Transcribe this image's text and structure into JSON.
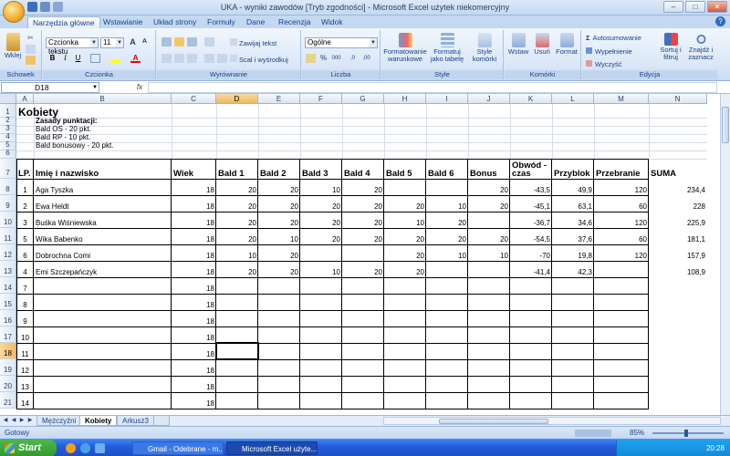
{
  "window": {
    "title": "UKA - wyniki zawodów  [Tryb zgodności]  -  Microsoft Excel użytek niekomercyjny",
    "controls": [
      "–",
      "□",
      "✕"
    ]
  },
  "ribbon_tabs": [
    "Narzędzia główne",
    "Wstawianie",
    "Układ strony",
    "Formuły",
    "Dane",
    "Recenzja",
    "Widok"
  ],
  "active_tab": "Narzędzia główne",
  "ribbon": {
    "groups": [
      "Schowek",
      "Czcionka",
      "Wyrównanie",
      "Liczba",
      "Style",
      "Komórki",
      "Edycja"
    ],
    "paste_label": "Wklej",
    "font_name": "Czcionka tekstu",
    "font_size": "11",
    "grow_font": "A",
    "shrink_font": "A",
    "bold": "B",
    "italic": "I",
    "underline": "U",
    "font_color_letter": "A",
    "wrap_text": "Zawijaj tekst",
    "merge_center": "Scal i wyśrodkuj",
    "number_format": "Ogólne",
    "percent": "%",
    "thousands": "000",
    "dec_inc": ",0",
    "dec_dec": ",00",
    "cond_format": [
      "Formatowanie",
      "warunkowe"
    ],
    "format_table": [
      "Formatuj",
      "jako tabelę"
    ],
    "cell_styles": [
      "Style",
      "komórki"
    ],
    "insert": "Wstaw",
    "delete": "Usuń",
    "format": "Format",
    "autosum": "Autosumowanie",
    "fill": "Wypełnienie",
    "clear": "Wyczyść",
    "sort_filter": [
      "Sortuj i",
      "filtruj"
    ],
    "find_select": [
      "Znajdź i",
      "zaznacz"
    ]
  },
  "formula_bar": {
    "name_box": "D18",
    "fx": "fx",
    "content": ""
  },
  "columns": [
    "A",
    "B",
    "C",
    "D",
    "E",
    "F",
    "G",
    "H",
    "I",
    "J",
    "K",
    "L",
    "M",
    "N"
  ],
  "selected_column": "D",
  "rows": [
    "1",
    "2",
    "3",
    "4",
    "5",
    "6",
    "7",
    "8",
    "9",
    "10",
    "11",
    "12",
    "13",
    "14",
    "15",
    "16",
    "17",
    "18",
    "19",
    "20",
    "21"
  ],
  "selected_row": "18",
  "sheet": {
    "title": "Kobiety",
    "rules_header": "Zasady punktacji:",
    "rules": [
      "Bald OS - 20 pkt.",
      "Bald RP - 10 pkt.",
      "Bald bonusowy - 20 pkt."
    ],
    "headers": [
      "LP.",
      "Imię i nazwisko",
      "Wiek",
      "Bald 1",
      "Bald 2",
      "Bald 3",
      "Bald 4",
      "Bald 5",
      "Bald 6",
      "Bonus",
      "Obwód - czas",
      "Przyblok",
      "Przebranie",
      "SUMA"
    ],
    "header_k_lines": [
      "Obwód -",
      "czas"
    ],
    "data_rows": [
      [
        "1",
        "Aga Tyszka",
        "18",
        "20",
        "20",
        "10",
        "20",
        "",
        "",
        "20",
        "-43,5",
        "49,9",
        "120",
        "234,4"
      ],
      [
        "2",
        "Ewa Heldt",
        "18",
        "20",
        "20",
        "20",
        "20",
        "20",
        "10",
        "20",
        "-45,1",
        "63,1",
        "60",
        "228"
      ],
      [
        "3",
        "Buśka Wiśniewska",
        "18",
        "20",
        "20",
        "20",
        "20",
        "10",
        "20",
        "",
        "-36,7",
        "34,6",
        "120",
        "225,9"
      ],
      [
        "5",
        "Wika Babenko",
        "18",
        "20",
        "10",
        "20",
        "20",
        "20",
        "20",
        "20",
        "-54,5",
        "37,6",
        "60",
        "181,1"
      ],
      [
        "6",
        "Dobrochna Comi",
        "18",
        "10",
        "20",
        "",
        "",
        "20",
        "10",
        "10",
        "-70",
        "19,8",
        "120",
        "157,9"
      ],
      [
        "4",
        "Emi Szczepańczyk",
        "18",
        "20",
        "20",
        "10",
        "20",
        "20",
        "",
        "",
        "-41,4",
        "42,3",
        "",
        "108,9"
      ]
    ],
    "empty_rows": [
      [
        "7",
        "18"
      ],
      [
        "8",
        "18"
      ],
      [
        "9",
        "18"
      ],
      [
        "10",
        "18"
      ],
      [
        "11",
        "18"
      ],
      [
        "12",
        "18"
      ],
      [
        "13",
        "18"
      ],
      [
        "14",
        "18"
      ]
    ]
  },
  "sheet_tabs": [
    "Mężczyźni",
    "Kobiety",
    "Arkusz3"
  ],
  "active_sheet": "Kobiety",
  "status": {
    "ready": "Gotowy",
    "zoom": "85%"
  },
  "taskbar": {
    "start": "Start",
    "tasks": [
      "Gmail - Odebrane - m...",
      "Microsoft Excel użyte..."
    ],
    "clock": "20:28"
  }
}
